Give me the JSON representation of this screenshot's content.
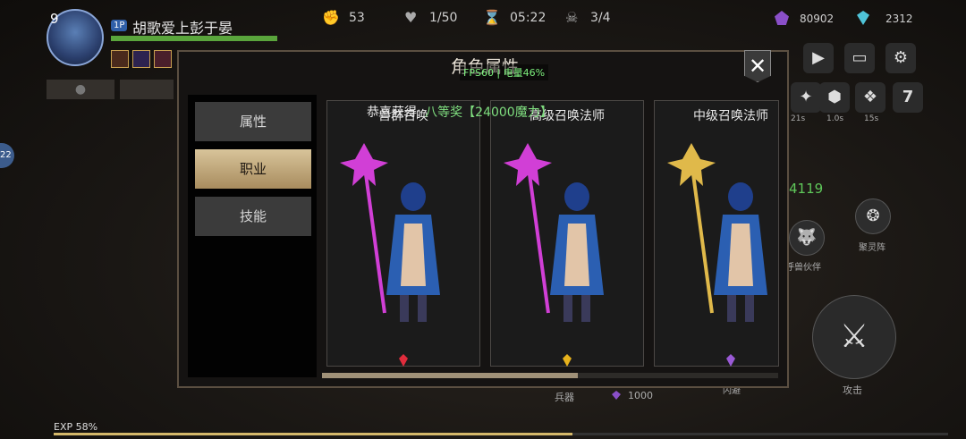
{
  "player": {
    "level": "9",
    "tag": "1P",
    "name": "胡歌爱上彭于晏",
    "hp_fraction": 1.0
  },
  "hud_stats": [
    {
      "icon": "fist-icon",
      "value": "53"
    },
    {
      "icon": "heart-pulse-icon",
      "value": "1/50"
    },
    {
      "icon": "timer-icon",
      "value": "05:22"
    },
    {
      "icon": "demon-mask-icon",
      "value": "3/4"
    }
  ],
  "currencies": [
    {
      "icon": "purple-gem-icon",
      "value": "80902",
      "color": "#8a4fc8"
    },
    {
      "icon": "cyan-crystal-icon",
      "value": "2312",
      "color": "#4fc3d8"
    }
  ],
  "modal": {
    "title": "角色属性",
    "fps_text": "FPS60 | 电量46%",
    "close_symbol": "✕",
    "tabs": [
      {
        "label": "属性",
        "active": false
      },
      {
        "label": "职业",
        "active": true
      },
      {
        "label": "技能",
        "active": false
      }
    ],
    "notice": {
      "prefix": "恭喜获得:",
      "reward": "八等奖【24000魔力】"
    },
    "cards": [
      {
        "title": "兽群召唤",
        "staff_color": "#d13fd6",
        "gem_color": "#e02c3c"
      },
      {
        "title": "高级召唤法师",
        "staff_color": "#d13fd6",
        "gem_color": "#e7b21c"
      },
      {
        "title": "中级召唤法师",
        "staff_color": "#e0b94a",
        "gem_color": "#9a5ad6"
      }
    ],
    "scroll_fraction": 0.56
  },
  "side": {
    "cooldowns": [
      "21s",
      "1.0s",
      "15s"
    ],
    "score": "4119",
    "skill_labels": [
      "呼兽伙伴",
      "聚灵阵"
    ],
    "attack_label": "攻击",
    "bottom_labels": [
      "兵器",
      "1000",
      "闪避"
    ]
  },
  "exp": {
    "label": "EXP 58%",
    "fraction": 0.58
  },
  "left_badge": "22"
}
